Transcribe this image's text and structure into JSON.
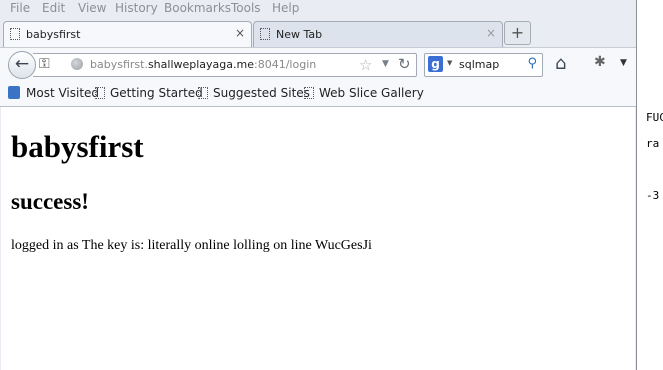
{
  "menu": [
    "File",
    "Edit",
    "View",
    "History",
    "Bookmarks",
    "Tools",
    "Help"
  ],
  "tabs": [
    {
      "label": "babysfirst",
      "close": "×"
    },
    {
      "label": "New Tab",
      "close": "×"
    }
  ],
  "new_tab_symbol": "+",
  "navbar": {
    "url_pre": "babysfirst.",
    "url_host": "shallweplayaga.me",
    "url_post": ":8041/login",
    "search_engine_letter": "g",
    "search_value": "sqlmap"
  },
  "bookmarks": [
    "Most Visited",
    "Getting Started",
    "Suggested Sites",
    "Web Slice Gallery"
  ],
  "page": {
    "heading": "babysfirst",
    "subheading": "success!",
    "message": "logged in as The key is: literally online lolling on line WucGesJi"
  },
  "terminal": [
    "FUC",
    "ra",
    "-3"
  ],
  "icons": {
    "back": "back-arrow-icon",
    "identity": "key-icon",
    "site": "globe-icon",
    "bookmark_star": "star-icon",
    "reload": "reload-icon",
    "search": "magnifier-icon",
    "home": "home-icon"
  }
}
